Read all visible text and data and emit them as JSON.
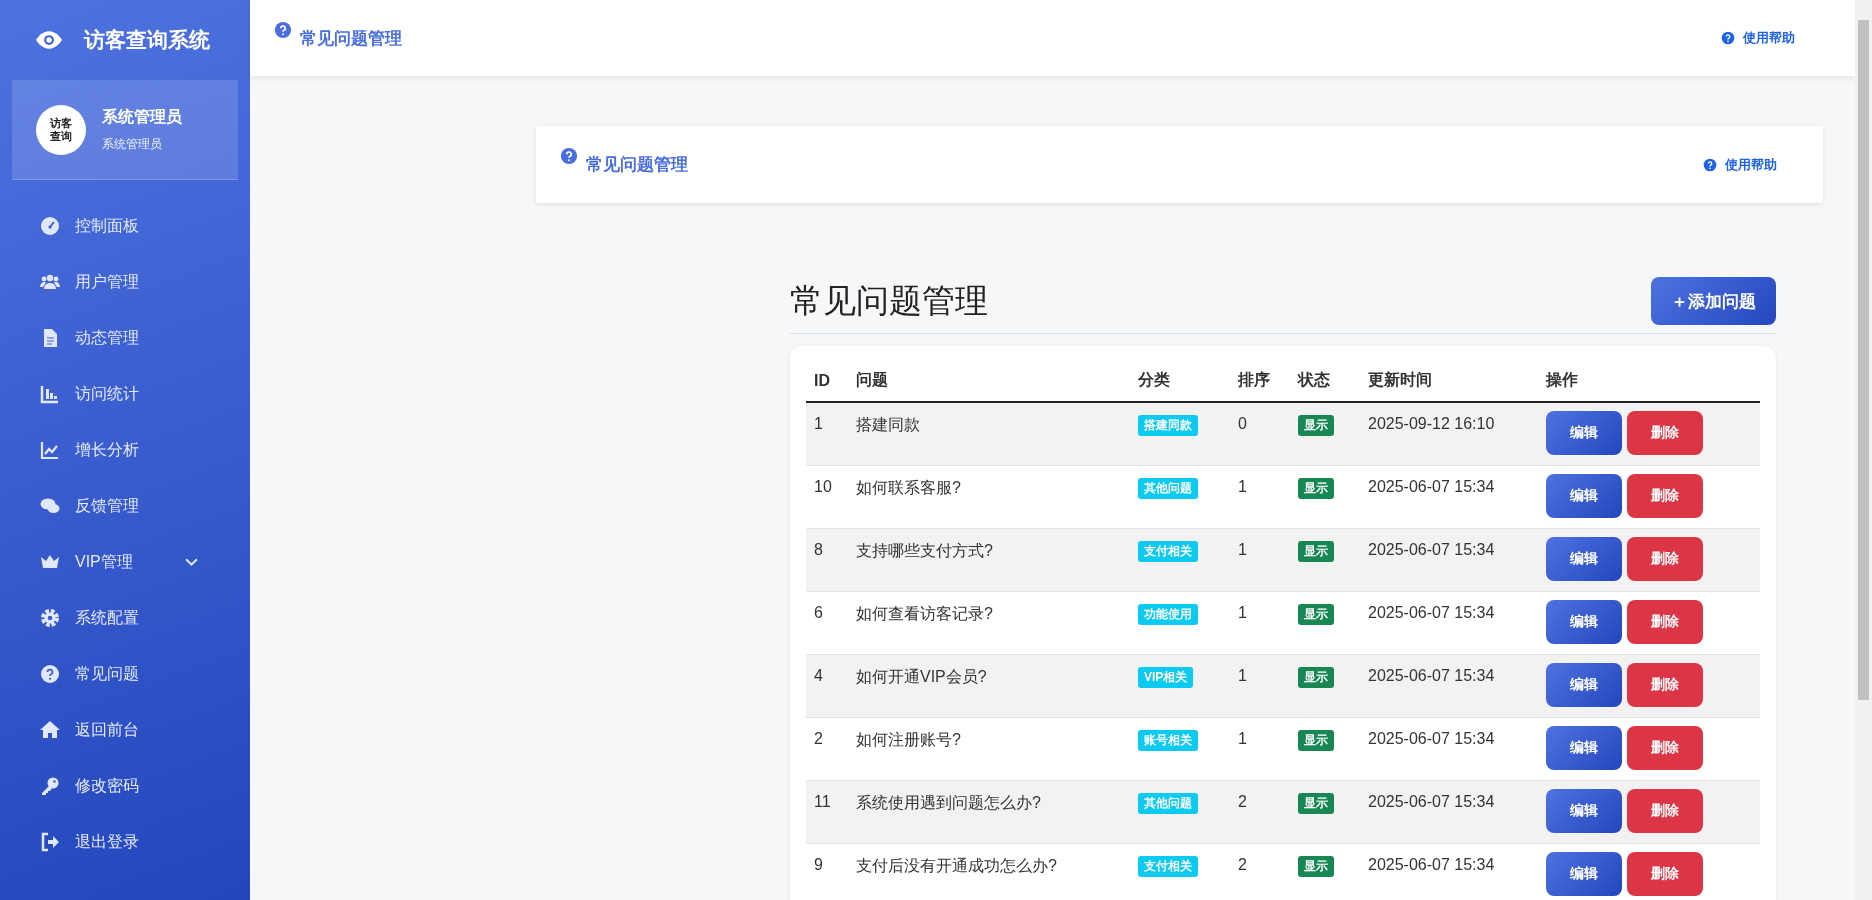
{
  "sidebar": {
    "brand": "访客查询系统",
    "user": {
      "avatar_text": "访客查询",
      "name": "系统管理员",
      "role": "系统管理员"
    },
    "items": [
      {
        "label": "控制面板",
        "has_submenu": false
      },
      {
        "label": "用户管理",
        "has_submenu": false
      },
      {
        "label": "动态管理",
        "has_submenu": false
      },
      {
        "label": "访问统计",
        "has_submenu": false
      },
      {
        "label": "增长分析",
        "has_submenu": false
      },
      {
        "label": "反馈管理",
        "has_submenu": false
      },
      {
        "label": "VIP管理",
        "has_submenu": true
      },
      {
        "label": "系统配置",
        "has_submenu": false
      },
      {
        "label": "常见问题",
        "has_submenu": false
      },
      {
        "label": "返回前台",
        "has_submenu": false
      },
      {
        "label": "修改密码",
        "has_submenu": false
      },
      {
        "label": "退出登录",
        "has_submenu": false
      }
    ]
  },
  "header": {
    "title": "常见问题管理",
    "help": "使用帮助"
  },
  "panel": {
    "title": "常见问题管理",
    "help": "使用帮助"
  },
  "page_title": "常见问题管理",
  "add_button": "＋添加问题",
  "table": {
    "columns": [
      "ID",
      "问题",
      "分类",
      "排序",
      "状态",
      "更新时间",
      "操作"
    ],
    "rows": [
      {
        "id": "1",
        "question": "搭建同款",
        "category": "搭建同款",
        "order": "0",
        "status": "显示",
        "updated": "2025-09-12 16:10",
        "actions": [
          "编辑",
          "删除"
        ]
      },
      {
        "id": "10",
        "question": "如何联系客服?",
        "category": "其他问题",
        "order": "1",
        "status": "显示",
        "updated": "2025-06-07 15:34",
        "actions": [
          "编辑",
          "删除"
        ]
      },
      {
        "id": "8",
        "question": "支持哪些支付方式?",
        "category": "支付相关",
        "order": "1",
        "status": "显示",
        "updated": "2025-06-07 15:34",
        "actions": [
          "编辑",
          "删除"
        ]
      },
      {
        "id": "6",
        "question": "如何查看访客记录?",
        "category": "功能使用",
        "order": "1",
        "status": "显示",
        "updated": "2025-06-07 15:34",
        "actions": [
          "编辑",
          "删除"
        ]
      },
      {
        "id": "4",
        "question": "如何开通VIP会员?",
        "category": "VIP相关",
        "order": "1",
        "status": "显示",
        "updated": "2025-06-07 15:34",
        "actions": [
          "编辑",
          "删除"
        ]
      },
      {
        "id": "2",
        "question": "如何注册账号?",
        "category": "账号相关",
        "order": "1",
        "status": "显示",
        "updated": "2025-06-07 15:34",
        "actions": [
          "编辑",
          "删除"
        ]
      },
      {
        "id": "11",
        "question": "系统使用遇到问题怎么办?",
        "category": "其他问题",
        "order": "2",
        "status": "显示",
        "updated": "2025-06-07 15:34",
        "actions": [
          "编辑",
          "删除"
        ]
      },
      {
        "id": "9",
        "question": "支付后没有开通成功怎么办?",
        "category": "支付相关",
        "order": "2",
        "status": "显示",
        "updated": "2025-06-07 15:34",
        "actions": [
          "编辑",
          "删除"
        ]
      }
    ]
  }
}
